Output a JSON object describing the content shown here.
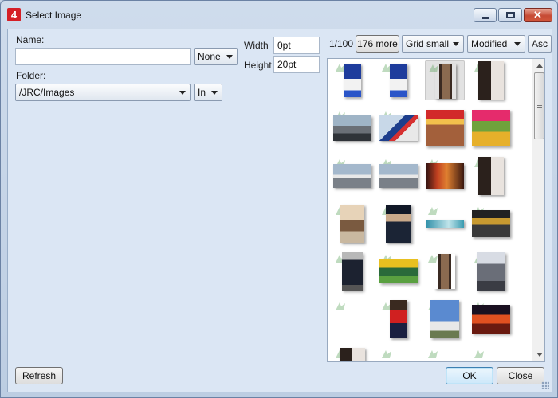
{
  "window": {
    "title": "Select Image",
    "app_icon_text": "4"
  },
  "form": {
    "name_label": "Name:",
    "name_value": "",
    "name_mode": "None",
    "folder_label": "Folder:",
    "folder_value": "/JRC/Images",
    "folder_mode": "In",
    "width_label": "Width",
    "width_value": "0pt",
    "height_label": "Height",
    "height_value": "20pt"
  },
  "toolbar": {
    "page_indicator": "1/100",
    "more_button": "176 more",
    "view_mode": "Grid small",
    "sort_field": "Modified",
    "sort_order": "Asc"
  },
  "thumbnails": [
    {
      "icon": "person-with-trophy-icon"
    },
    {
      "icon": "person-with-trophy-icon"
    },
    {
      "icon": "wooden-chair-icon",
      "selected": true
    },
    {
      "icon": "wedding-couple-icon"
    },
    {
      "icon": "street-scene-icon"
    },
    {
      "icon": "airplane-tail-icon"
    },
    {
      "icon": "magazine-cover-icon"
    },
    {
      "icon": "tradgard-magazine-icon"
    },
    {
      "icon": "airplane-icon"
    },
    {
      "icon": "airplane-icon"
    },
    {
      "icon": "dancers-icon"
    },
    {
      "icon": "wedding-couple-icon"
    },
    {
      "icon": "couple-portrait-icon"
    },
    {
      "icon": "man-portrait-icon"
    },
    {
      "icon": "phone-banner-icon"
    },
    {
      "icon": "worker-icon"
    },
    {
      "icon": "man-walking-icon"
    },
    {
      "icon": "cyclist-icon"
    },
    {
      "icon": "wooden-chair-icon"
    },
    {
      "icon": "eiffel-tower-icon"
    },
    {
      "icon": "image-placeholder-icon"
    },
    {
      "icon": "man-in-red-icon"
    },
    {
      "icon": "power-plant-icon"
    },
    {
      "icon": "fire-icon"
    },
    {
      "icon": "wedding-couple-icon"
    },
    {
      "icon": "image-placeholder-icon"
    },
    {
      "icon": "image-placeholder-icon"
    },
    {
      "icon": "image-placeholder-icon"
    }
  ],
  "buttons": {
    "refresh": "Refresh",
    "ok": "OK",
    "close": "Close"
  }
}
